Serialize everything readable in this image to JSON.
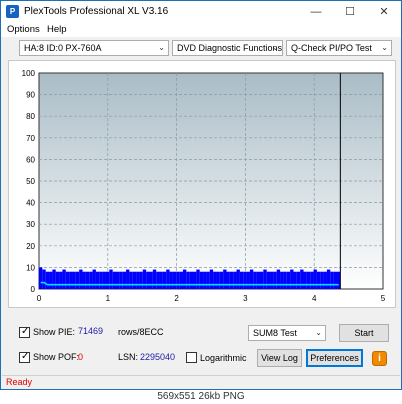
{
  "window": {
    "title": "PlexTools Professional XL V3.16",
    "app_icon_glyph": "P",
    "minimize_glyph": "—",
    "maximize_glyph": "☐",
    "close_glyph": "✕"
  },
  "menu": {
    "options": "Options",
    "help": "Help"
  },
  "toolbar": {
    "drive": "HA:8 ID:0  PX-760A",
    "function": "DVD Diagnostic Functions",
    "test": "Q-Check PI/PO Test",
    "dropdown_arrow": "⌄"
  },
  "chart_data": {
    "type": "bar",
    "y_ticks": [
      "100",
      "90",
      "80",
      "70",
      "60",
      "50",
      "40",
      "30",
      "20",
      "10",
      "0"
    ],
    "x_ticks": [
      "0",
      "1",
      "2",
      "3",
      "4",
      "5"
    ],
    "xlim": [
      0,
      5
    ],
    "ylim": [
      0,
      100
    ],
    "data_end_x": 4.38,
    "grid": true,
    "series": [
      {
        "color": "#0000ff",
        "values": [
          10,
          9,
          8,
          8,
          9,
          8,
          8,
          9,
          8,
          8,
          8,
          8,
          9,
          8,
          8,
          8,
          9,
          8,
          8,
          8,
          8,
          9,
          8,
          8,
          8,
          8,
          9,
          8,
          8,
          8,
          8,
          9,
          8,
          8,
          9,
          8,
          8,
          8,
          9,
          8,
          8,
          8,
          8,
          9,
          8,
          8,
          8,
          9,
          8,
          8,
          8,
          9,
          8,
          8,
          8,
          9,
          8,
          8,
          8,
          9,
          8,
          8,
          8,
          9,
          8,
          8,
          8,
          9,
          8,
          8,
          8,
          9,
          8,
          8,
          8,
          9,
          8,
          8,
          9,
          8,
          8,
          8,
          9,
          8,
          8,
          8,
          9,
          8,
          8,
          8
        ]
      },
      {
        "color": "#00e0ff",
        "values": [
          3,
          3,
          2,
          2,
          2,
          2,
          2,
          2,
          2,
          2,
          2,
          2,
          2,
          2,
          2,
          2,
          2,
          2,
          2,
          2,
          2,
          2,
          2,
          2,
          2,
          2,
          2,
          2,
          2,
          2,
          2,
          2,
          2,
          2,
          2,
          2,
          2,
          2,
          2,
          2,
          2,
          2,
          2,
          2,
          2,
          2,
          2,
          2,
          2,
          2,
          2,
          2,
          2,
          2,
          2,
          2,
          2,
          2,
          2,
          2,
          2,
          2,
          2,
          2,
          2,
          2,
          2,
          2,
          2,
          2,
          2,
          2,
          2,
          2,
          2,
          2,
          2,
          2,
          2,
          2,
          2,
          2,
          2,
          2,
          2,
          2,
          2,
          2,
          2,
          2
        ]
      }
    ]
  },
  "controls": {
    "show_pie_label": "Show PIE:",
    "show_pie_checked": true,
    "pie_value": "71469",
    "pie_unit": "rows/8ECC",
    "show_poe_label": "Show POF:",
    "show_poe_checked": true,
    "poe_value": "0",
    "lsn_label": "LSN:",
    "lsn_value": "2295040",
    "logarithmic_label": "Logarithmic",
    "logarithmic_checked": false,
    "test_mode": "SUM8 Test",
    "start_button": "Start",
    "view_log_button": "View Log",
    "preferences_button": "Preferences",
    "info_glyph": "i"
  },
  "status": {
    "text": "Ready"
  },
  "caption": "569x551  26kb  PNG"
}
